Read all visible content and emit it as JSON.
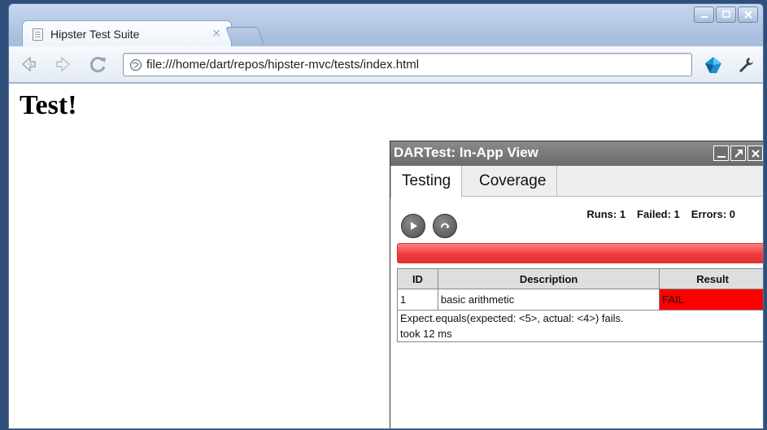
{
  "browser": {
    "tab_title": "Hipster Test Suite",
    "tab_close": "×",
    "url": "file:///home/dart/repos/hipster-mvc/tests/index.html",
    "icons": [
      "back-icon",
      "forward-icon",
      "reload-icon",
      "globe-icon",
      "extension-icon",
      "wrench-icon",
      "minimize-icon",
      "maximize-icon",
      "close-icon",
      "page-icon"
    ]
  },
  "page": {
    "heading": "Test!"
  },
  "dartest": {
    "title": "DARTest: In-App View",
    "tabs": [
      "Testing",
      "Coverage"
    ],
    "active_tab": "Testing",
    "stats": {
      "runs": "Runs: 1",
      "failed": "Failed: 1",
      "errors": "Errors: 0"
    },
    "progress_color": "#ef3b3b",
    "columns": [
      "ID",
      "Description",
      "Result"
    ],
    "rows": [
      {
        "id": "1",
        "description": "basic arithmetic",
        "result": "FAIL"
      }
    ],
    "message_line1": "Expect.equals(expected: <5>, actual: <4>) fails.",
    "message_line2": "took 12 ms"
  }
}
